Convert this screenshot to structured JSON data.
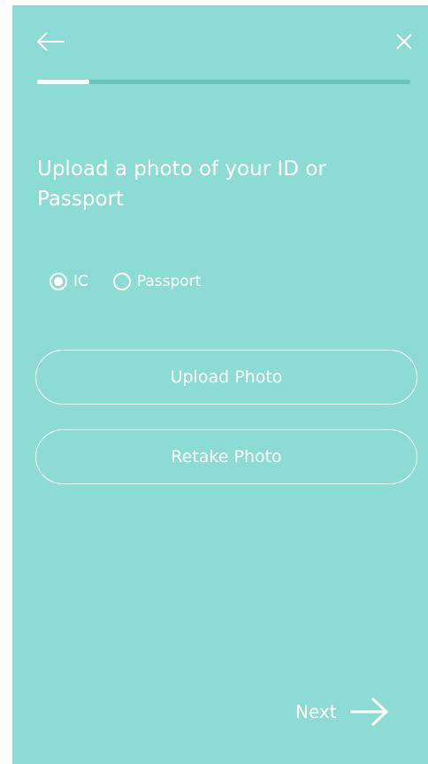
{
  "header": {
    "back_icon": "arrow-left-icon",
    "close_icon": "close-icon",
    "progress_fraction": 0.14
  },
  "main": {
    "title": "Upload a photo of your ID or Passport",
    "id_type": {
      "options": [
        "IC",
        "Passport"
      ],
      "selected": "IC"
    },
    "upload_button": "Upload Photo",
    "retake_button": "Retake Photo"
  },
  "footer": {
    "next_label": "Next",
    "next_icon": "arrow-right-icon"
  },
  "colors": {
    "background": "#8cdbd4",
    "progress_track": "#6fc2bb",
    "foreground": "#ffffff"
  }
}
